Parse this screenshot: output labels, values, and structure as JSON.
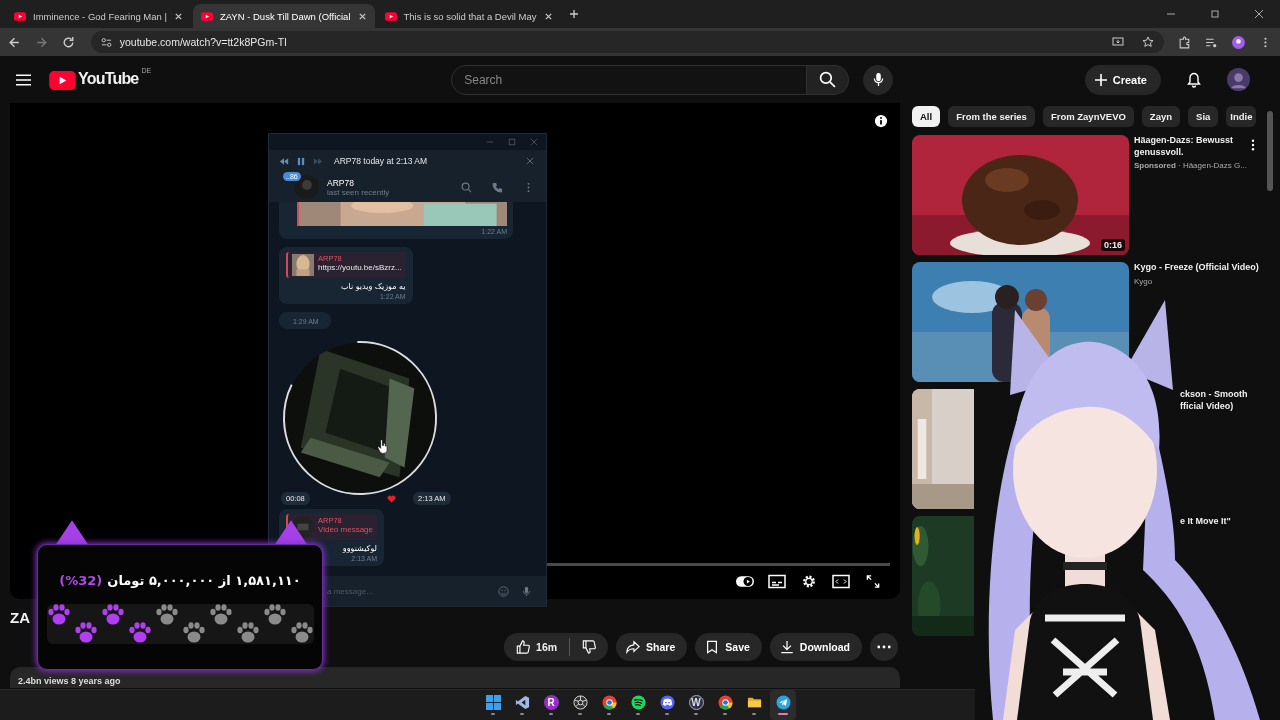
{
  "browser": {
    "tabs": [
      {
        "title": "Imminence - God Fearing Man |",
        "selected": false
      },
      {
        "title": "ZAYN - Dusk Till Dawn (Official",
        "selected": true
      },
      {
        "title": "This is so solid that a Devil May",
        "selected": false
      }
    ],
    "url": "youtube.com/watch?v=tt2k8PGm-TI"
  },
  "header": {
    "logo": "YouTube",
    "region": "DE",
    "search": {
      "placeholder": "Search"
    },
    "create": "Create"
  },
  "video": {
    "title": "ZA",
    "likes": "16m",
    "actions": [
      {
        "kind": "share",
        "label": "Share"
      },
      {
        "kind": "save",
        "label": "Save"
      },
      {
        "kind": "download",
        "label": "Download"
      }
    ],
    "views": "2.4bn views  8 years ago"
  },
  "chips": [
    {
      "label": "All",
      "selected": true
    },
    {
      "label": "From the series",
      "selected": false
    },
    {
      "label": "From ZaynVEVO",
      "selected": false
    },
    {
      "label": "Zayn",
      "selected": false
    },
    {
      "label": "Sia",
      "selected": false
    },
    {
      "label": "Indie",
      "selected": false
    }
  ],
  "recommendations": [
    {
      "kind": "full",
      "title": "Häagen-Dazs: Bewusst genussvoll.",
      "meta": "**Sponsored** · Häagen-Dazs G...",
      "duration": "0:16"
    },
    {
      "kind": "full",
      "title": "Kygo - Freeze (Official Video)",
      "meta": "Kygo"
    },
    {
      "kind": "partial",
      "title": "ckson - Smooth\nfficial Video)"
    },
    {
      "kind": "partial",
      "title": "e It Move It\""
    }
  ],
  "telegram": {
    "player": "ARP78 today at 2:13 AM",
    "unread": "..86",
    "chat": {
      "name": "ARP78",
      "status": "last seen recently"
    },
    "messages": [
      {
        "time": "1:22 AM"
      },
      {
        "kind": "reply",
        "author": "ARP78",
        "quote": "https://youtu.be/sBzrz...",
        "text": "یه موزیک ویدیو ناب",
        "time": "1:22 AM"
      },
      {
        "kind": "stamp",
        "time": "1:29 AM"
      },
      {
        "kind": "video",
        "duration": "00:08",
        "time": "2:13 AM"
      },
      {
        "kind": "reply",
        "author": "ARP78",
        "quote": "Video message",
        "text": "لوکیشنووو",
        "time": "2:13 AM"
      }
    ],
    "input": {
      "placeholder": "a message..."
    }
  },
  "donation": {
    "percent": "(%32)",
    "amount": "۱,۵۸۱,۱۱۰ از ۵,۰۰۰,۰۰۰ تومان",
    "level": 0.4
  },
  "taskbar": [
    {
      "kind": "start",
      "selected": false
    },
    {
      "kind": "code",
      "selected": false
    },
    {
      "kind": "letter",
      "label": "R",
      "selected": false
    },
    {
      "kind": "aperture",
      "selected": false
    },
    {
      "kind": "browser",
      "selected": false
    },
    {
      "kind": "music",
      "selected": false
    },
    {
      "kind": "chat",
      "selected": false
    },
    {
      "kind": "letter",
      "label": "W",
      "selected": false
    },
    {
      "kind": "browser",
      "selected": false
    },
    {
      "kind": "folder",
      "selected": false
    },
    {
      "kind": "plane",
      "selected": true
    }
  ]
}
